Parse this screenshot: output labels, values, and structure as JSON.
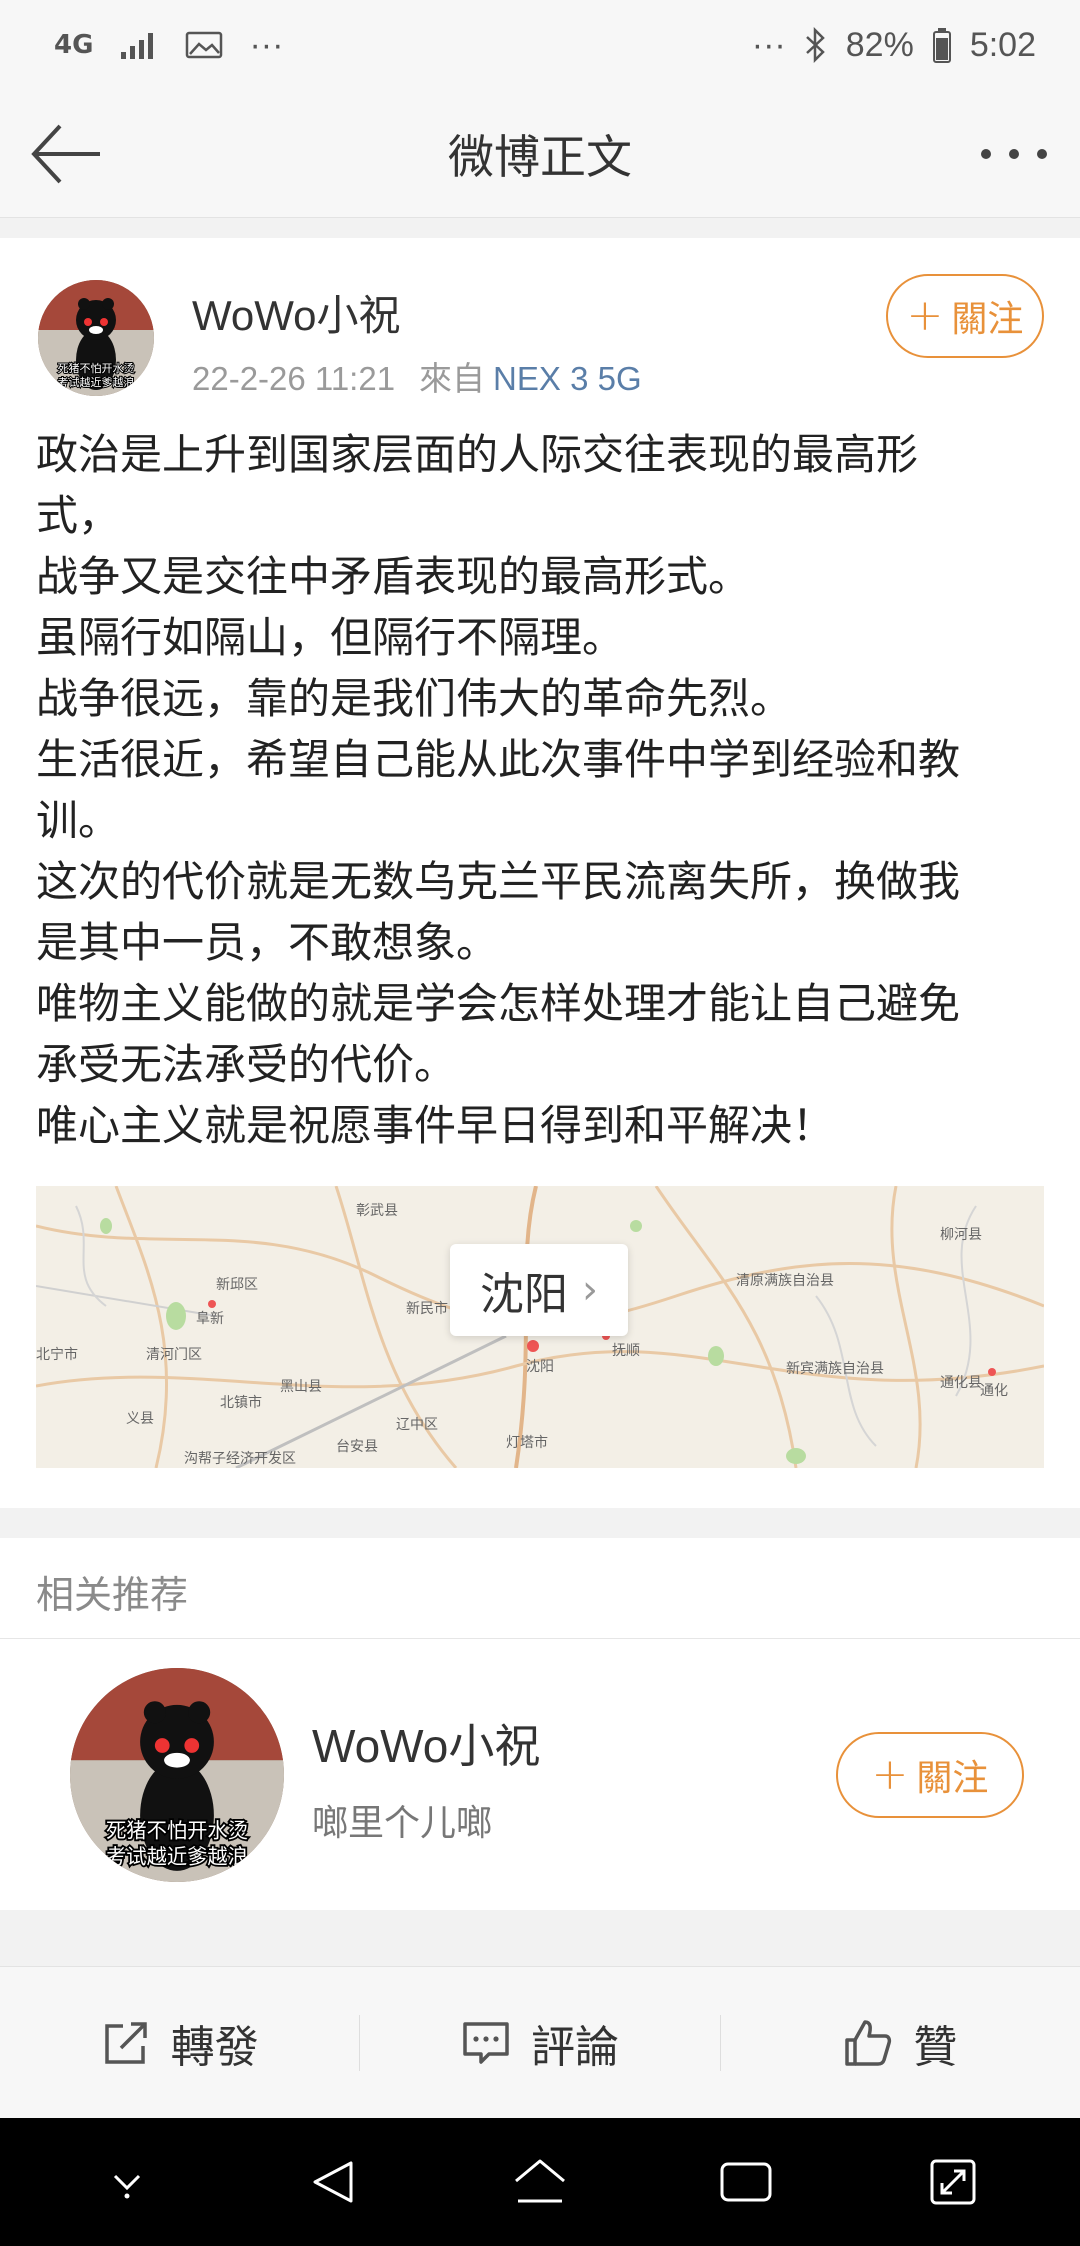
{
  "status_bar": {
    "network": "4G",
    "left_dots": "···",
    "right_dots": "···",
    "battery": "82%",
    "time": "5:02"
  },
  "nav": {
    "title": "微博正文"
  },
  "post": {
    "author": "WoWo小祝",
    "timestamp": "22-2-26 11:21",
    "from_label": "來自",
    "device": "NEX 3 5G",
    "follow_label": "關注",
    "lines": [
      "政治是上升到国家层面的人际交往表现的最高形",
      "式，",
      "战争又是交往中矛盾表现的最高形式。",
      "虽隔行如隔山，但隔行不隔理。",
      "战争很远，靠的是我们伟大的革命先烈。",
      "生活很近，希望自己能从此次事件中学到经验和教",
      "训。",
      "这次的代价就是无数乌克兰平民流离失所，换做我",
      "是其中一员，不敢想象。",
      "唯物主义能做的就是学会怎样处理才能让自己避免",
      "承受无法承受的代价。",
      "唯心主义就是祝愿事件早日得到和平解决！"
    ],
    "location": {
      "city": "沈阳",
      "places": [
        "彰武县",
        "阜新",
        "新邱区",
        "新民市",
        "清河门区",
        "北宁市",
        "黑山县",
        "北镇市",
        "义县",
        "台安县",
        "辽中区",
        "沈阳",
        "抚顺",
        "灯塔市",
        "清原满族自治县",
        "新宾满族自治县",
        "柳河县",
        "通化县",
        "通化",
        "沟帮子经济开发区"
      ]
    }
  },
  "related": {
    "title": "相关推荐",
    "user": {
      "name": "WoWo小祝",
      "desc": "啷里个儿啷",
      "follow_label": "關注"
    }
  },
  "actions": {
    "repost": "轉發",
    "comment": "評論",
    "like": "贊"
  },
  "avatar": {
    "caption_line1": "死猪不怕开水烫",
    "caption_line2": "考试越近爹越浪"
  },
  "colors": {
    "accent": "#e8913a",
    "link": "#5a7ea8"
  }
}
